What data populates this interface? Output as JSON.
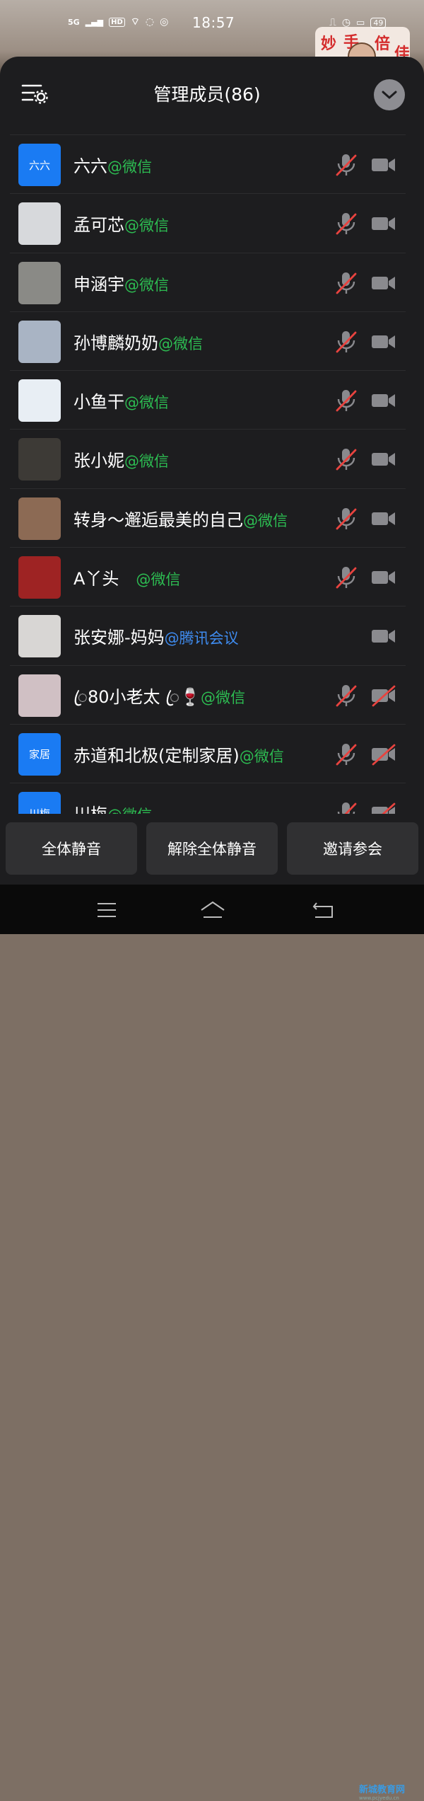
{
  "status_bar": {
    "network": "5G",
    "hd": "HD",
    "time": "18:57",
    "battery": "49"
  },
  "header": {
    "title": "管理成员(86)"
  },
  "members": [
    {
      "name": "六六",
      "tag": "@微信",
      "tag_type": "wx",
      "avatar_text": "六六",
      "avatar_color": "#1a7bf3",
      "mic_muted": true,
      "cam_off": false
    },
    {
      "name": "孟可芯",
      "tag": "@微信",
      "tag_type": "wx",
      "avatar_text": "",
      "avatar_color": "#d7d9dc",
      "mic_muted": true,
      "cam_off": false
    },
    {
      "name": "申涵宇",
      "tag": "@微信",
      "tag_type": "wx",
      "avatar_text": "",
      "avatar_color": "#8a8a86",
      "mic_muted": true,
      "cam_off": false
    },
    {
      "name": "孙博麟奶奶",
      "tag": "@微信",
      "tag_type": "wx",
      "avatar_text": "",
      "avatar_color": "#a9b4c4",
      "mic_muted": true,
      "cam_off": false
    },
    {
      "name": "小鱼干",
      "tag": "@微信",
      "tag_type": "wx",
      "avatar_text": "",
      "avatar_color": "#e8eef4",
      "mic_muted": true,
      "cam_off": false
    },
    {
      "name": "张小妮",
      "tag": "@微信",
      "tag_type": "wx",
      "avatar_text": "",
      "avatar_color": "#3d3a36",
      "mic_muted": true,
      "cam_off": false
    },
    {
      "name": "转身～邂逅最美的自己",
      "tag": "@微信",
      "tag_type": "wx",
      "avatar_text": "",
      "avatar_color": "#8c6a54",
      "mic_muted": true,
      "cam_off": false
    },
    {
      "name": "A丫头　",
      "tag": "@微信",
      "tag_type": "wx",
      "avatar_text": "",
      "avatar_color": "#9e2323",
      "mic_muted": true,
      "cam_off": false
    },
    {
      "name": "张安娜-妈妈",
      "tag": "@腾讯会议",
      "tag_type": "tx",
      "avatar_text": "",
      "avatar_color": "#d8d6d4",
      "mic_muted": false,
      "cam_off": false
    },
    {
      "name": "ꦿ80小老太 ꦿ🍷",
      "tag": "@微信",
      "tag_type": "wx",
      "avatar_text": "",
      "avatar_color": "#d0c0c4",
      "mic_muted": true,
      "cam_off": true
    },
    {
      "name": "赤道和北极(定制家居)",
      "tag": "@微信",
      "tag_type": "wx",
      "avatar_text": "家居",
      "avatar_color": "#1a7bf3",
      "mic_muted": true,
      "cam_off": true
    },
    {
      "name": "川梅",
      "tag": "@微信",
      "tag_type": "wx",
      "avatar_text": "川梅",
      "avatar_color": "#1a7bf3",
      "mic_muted": true,
      "cam_off": true
    }
  ],
  "actions": {
    "mute_all": "全体静音",
    "unmute_all": "解除全体静音",
    "invite": "邀请参会"
  },
  "watermark": {
    "text": "新城教育网",
    "url": "www.pcjyedu.cn"
  },
  "icons": {
    "settings": "settings-list-icon",
    "collapse": "chevron-down-icon",
    "mic": "mic-muted-icon",
    "camera": "camera-icon"
  }
}
